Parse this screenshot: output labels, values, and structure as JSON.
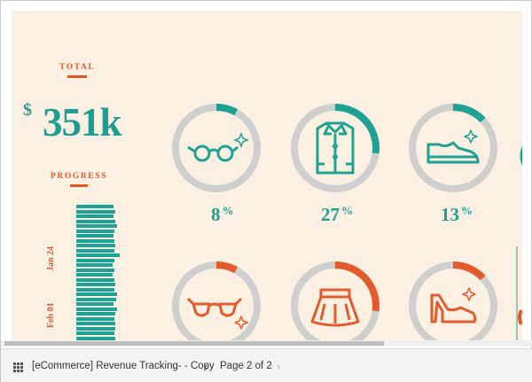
{
  "summary": {
    "total_label": "TOTAL",
    "currency": "$",
    "total_value": "351k",
    "progress_label": "PROGRESS"
  },
  "progress_bars": [
    0.7,
    0.73,
    0.7,
    0.74,
    0.77,
    0.72,
    0.7,
    0.71,
    0.74,
    0.72,
    0.81,
    0.71,
    0.68,
    0.71,
    0.68,
    0.72,
    0.74,
    0.71,
    0.76,
    0.75,
    0.7,
    0.76,
    0.74,
    0.71,
    0.74,
    0.73,
    0.72,
    0.73
  ],
  "date_labels": [
    "Jan 24",
    "Feb 01"
  ],
  "categories": [
    {
      "icon": "glasses-icon",
      "percent": 8,
      "percent_text": "8",
      "color": "#1fa294"
    },
    {
      "icon": "shirt-icon",
      "percent": 27,
      "percent_text": "27",
      "color": "#1fa294"
    },
    {
      "icon": "sneaker-icon",
      "percent": 13,
      "percent_text": "13",
      "color": "#1fa294"
    },
    {
      "icon": "sunglasses-icon",
      "percent": 8,
      "percent_text": "",
      "color": "#e35b2c"
    },
    {
      "icon": "skirt-icon",
      "percent": 27,
      "percent_text": "",
      "color": "#e35b2c"
    },
    {
      "icon": "heel-shoe-icon",
      "percent": 13,
      "percent_text": "",
      "color": "#e35b2c"
    }
  ],
  "percent_sign": "%",
  "colors": {
    "teal": "#1fa294",
    "orange": "#e35b2c",
    "ring_track": "#cfcfcf",
    "background": "#fbf0e2"
  },
  "footer": {
    "report_icon": "grid-icon",
    "report_name": "[eCommerce] Revenue Tracking- - Copy",
    "page_indicator": "Page 2 of 2",
    "prev_symbol": "‹",
    "next_symbol": "›"
  }
}
